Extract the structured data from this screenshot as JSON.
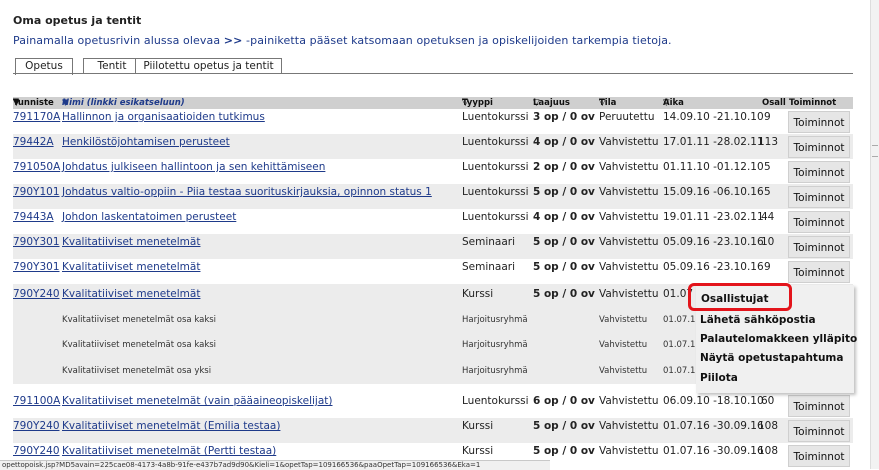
{
  "page": {
    "title": "Oma opetus ja tentit",
    "intro_prefix": "Painamalla opetusrivin alussa olevaa",
    "intro_symbol": ">>",
    "intro_suffix": "-painiketta pääset katsomaan opetuksen ja opiskelijoiden tarkempia tietoja."
  },
  "tabs": [
    "Opetus",
    "Tentit",
    "Piilotettu opetus ja tentit"
  ],
  "columns": {
    "tunniste": "Tunniste",
    "nimi": "Nimi (linkki esikatseluun)",
    "tyyppi": "Tyyppi",
    "laajuus": "Laajuus",
    "tila": "Tila",
    "aika": "Aika",
    "osall": "Osall",
    "toiminnot": "Toiminnot"
  },
  "rows": [
    {
      "code": "791170A",
      "name": "Hallinnon ja organisaatioiden tutkimus",
      "type": "Luentokurssi",
      "op": "3 op",
      "ov": "0 ov",
      "status": "Peruutettu",
      "time": "14.09.10 -21.10.10",
      "osall": "9",
      "action": "Toiminnot"
    },
    {
      "code": "79442A",
      "name": "Henkilöstöjohtamisen perusteet",
      "type": "Luentokurssi",
      "op": "4 op",
      "ov": "0 ov",
      "status": "Vahvistettu",
      "time": "17.01.11 -28.02.11",
      "osall": "113",
      "action": "Toiminnot"
    },
    {
      "code": "791050A",
      "name": "Johdatus julkiseen hallintoon ja sen kehittämiseen",
      "type": "Luentokurssi",
      "op": "2 op",
      "ov": "0 ov",
      "status": "Vahvistettu",
      "time": "01.11.10 -01.12.10",
      "osall": "5",
      "action": "Toiminnot"
    },
    {
      "code": "790Y101",
      "name": "Johdatus valtio-oppiin - Piia testaa suorituskirjauksia, opinnon status 1",
      "type": "Luentokurssi",
      "op": "5 op",
      "ov": "0 ov",
      "status": "Vahvistettu",
      "time": "15.09.16 -06.10.16",
      "osall": "5",
      "action": "Toiminnot"
    },
    {
      "code": "79443A",
      "name": "Johdon laskentatoimen perusteet",
      "type": "Luentokurssi",
      "op": "4 op",
      "ov": "0 ov",
      "status": "Vahvistettu",
      "time": "19.01.11 -23.02.11",
      "osall": "44",
      "action": "Toiminnot"
    },
    {
      "code": "790Y301",
      "name": "Kvalitatiiviset menetelmät",
      "type": "Seminaari",
      "op": "5 op",
      "ov": "0 ov",
      "status": "Vahvistettu",
      "time": "05.09.16 -23.10.16",
      "osall": "10",
      "action": "Toiminnot"
    },
    {
      "code": "790Y301",
      "name": "Kvalitatiiviset menetelmät",
      "type": "Seminaari",
      "op": "5 op",
      "ov": "0 ov",
      "status": "Vahvistettu",
      "time": "05.09.16 -23.10.16",
      "osall": "9",
      "action": "Toiminnot"
    },
    {
      "code": "790Y240",
      "name": "Kvalitatiiviset menetelmät",
      "type": "Kurssi",
      "op": "5 op",
      "ov": "0 ov",
      "status": "Vahvistettu",
      "time": "01.07",
      "osall": "",
      "action": ""
    }
  ],
  "subrows": [
    {
      "name": "Kvalitatiiviset menetelmät osa kaksi",
      "type": "Harjoitusryhmä",
      "status": "Vahvistettu",
      "time": "01.07.1"
    },
    {
      "name": "Kvalitatiiviset menetelmät osa kaksi",
      "type": "Harjoitusryhmä",
      "status": "Vahvistettu",
      "time": "01.07.1"
    },
    {
      "name": "Kvalitatiiviset menetelmät osa yksi",
      "type": "Harjoitusryhmä",
      "status": "Vahvistettu",
      "time": "01.07.1"
    }
  ],
  "rows_after": [
    {
      "code": "791100A",
      "name": "Kvalitatiiviset menetelmät (vain pääaineopiskelijat)",
      "type": "Luentokurssi",
      "op": "6 op",
      "ov": "0 ov",
      "status": "Vahvistettu",
      "time": "06.09.10 -18.10.10",
      "osall": "60",
      "action": "Toiminnot"
    },
    {
      "code": "790Y240",
      "name": "Kvalitatiiviset menetelmät (Emilia testaa)",
      "type": "Kurssi",
      "op": "5 op",
      "ov": "0 ov",
      "status": "Vahvistettu",
      "time": "01.07.16 -30.09.16",
      "osall": "108",
      "action": "Toiminnot"
    },
    {
      "code": "790Y240",
      "name": "Kvalitatiiviset menetelmät (Pertti testaa)",
      "type": "Kurssi",
      "op": "5 op",
      "ov": "0 ov",
      "status": "Vahvistettu",
      "time": "01.07.16 -30.09.16",
      "osall": "108",
      "action": "Toiminnot"
    }
  ],
  "context_menu": [
    "Osallistujat",
    "Lähetä sähköpostia",
    "Palautelomakkeen ylläpito",
    "Näytä opetustapahtuma",
    "Piilota"
  ],
  "status_url": "opettopoisk.jsp?MD5avain=225cae08-4173-4a8b-91fe-e437b7ad9d90&Kieli=1&opetTap=109166536&paaOpetTap=109166536&Eka=1",
  "colors": {
    "link": "#1e3a8a",
    "header_bg": "#cfcfcf",
    "row_shade": "#ececec",
    "highlight": "#e3141b"
  }
}
